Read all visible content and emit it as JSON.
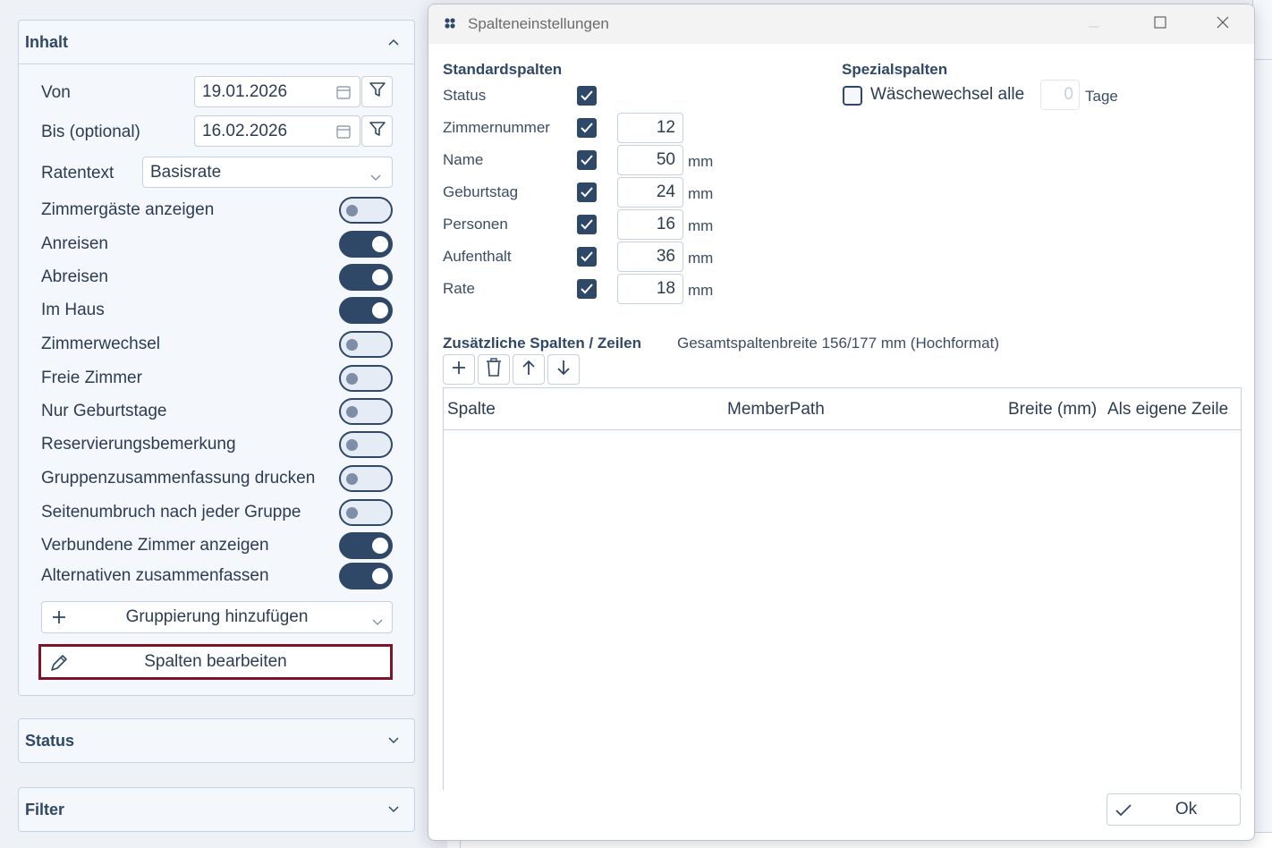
{
  "left_panel": {
    "inhalt": {
      "title": "Inhalt",
      "von": {
        "label": "Von",
        "value": "19.01.2026"
      },
      "bis": {
        "label": "Bis (optional)",
        "value": "16.02.2026"
      },
      "ratentext": {
        "label": "Ratentext",
        "value": "Basisrate"
      },
      "toggles": [
        {
          "label": "Zimmergäste anzeigen",
          "on": false
        },
        {
          "label": "Anreisen",
          "on": true
        },
        {
          "label": "Abreisen",
          "on": true
        },
        {
          "label": "Im Haus",
          "on": true
        },
        {
          "label": "Zimmerwechsel",
          "on": false
        },
        {
          "label": "Freie Zimmer",
          "on": false
        },
        {
          "label": "Nur Geburtstage",
          "on": false
        },
        {
          "label": "Reservierungsbemerkung",
          "on": false
        },
        {
          "label": "Gruppenzusammenfassung drucken",
          "on": false
        },
        {
          "label": "Seitenumbruch nach jeder Gruppe",
          "on": false
        },
        {
          "label": "Verbundene Zimmer anzeigen",
          "on": true
        },
        {
          "label": "Alternativen zusammenfassen",
          "on": true
        }
      ],
      "add_grouping": "Gruppierung hinzufügen",
      "edit_columns": "Spalten bearbeiten"
    },
    "status": {
      "title": "Status"
    },
    "filter": {
      "title": "Filter"
    }
  },
  "dialog": {
    "title": "Spalteneinstellungen",
    "standard": {
      "title": "Standardspalten",
      "rows": [
        {
          "label": "Status",
          "checked": true,
          "value": null,
          "unit": ""
        },
        {
          "label": "Zimmernummer",
          "checked": true,
          "value": "12",
          "unit": ""
        },
        {
          "label": "Name",
          "checked": true,
          "value": "50",
          "unit": "mm"
        },
        {
          "label": "Geburtstag",
          "checked": true,
          "value": "24",
          "unit": "mm"
        },
        {
          "label": "Personen",
          "checked": true,
          "value": "16",
          "unit": "mm"
        },
        {
          "label": "Aufenthalt",
          "checked": true,
          "value": "36",
          "unit": "mm"
        },
        {
          "label": "Rate",
          "checked": true,
          "value": "18",
          "unit": "mm"
        }
      ]
    },
    "special": {
      "title": "Spezialspalten",
      "label": "Wäschewechsel alle",
      "checked": false,
      "value": "0",
      "unit": "Tage"
    },
    "additional": {
      "title": "Zusätzliche Spalten / Zeilen",
      "total_width": "Gesamtspaltenbreite 156/177 mm (Hochformat)",
      "columns": [
        "Spalte",
        "MemberPath",
        "Breite (mm)",
        "Als eigene Zeile"
      ]
    },
    "ok_label": "Ok"
  },
  "colors": {
    "accent": "#2f4868",
    "highlight_border": "#7b1626"
  }
}
